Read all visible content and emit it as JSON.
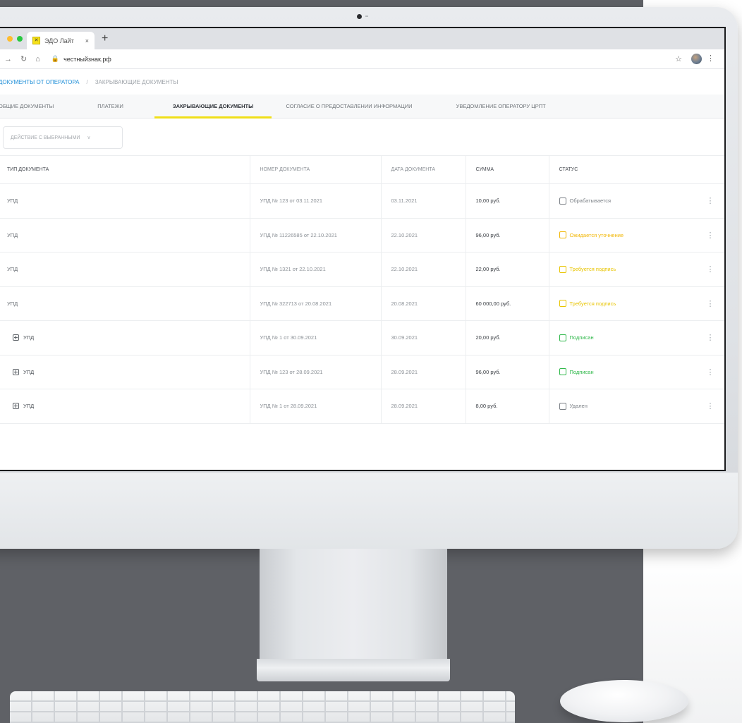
{
  "browser": {
    "tab_title": "ЭДО Лайт",
    "tab_close": "×",
    "new_tab": "+",
    "url": "честныйзнак.рф"
  },
  "breadcrumb": {
    "root": "ДОКУМЕНТЫ ОТ ОПЕРАТОРА",
    "separator": "/",
    "current": "ЗАКРЫВАЮЩИЕ ДОКУМЕНТЫ"
  },
  "tabs": [
    {
      "label": "ОБЩИЕ ДОКУМЕНТЫ",
      "active": false
    },
    {
      "label": "ПЛАТЕЖИ",
      "active": false
    },
    {
      "label": "ЗАКРЫВАЮЩИЕ ДОКУМЕНТЫ",
      "active": true
    },
    {
      "label": "СОГЛАСИЕ О ПРЕДОСТАВЛЕНИИ ИНФОРМАЦИИ",
      "active": false
    },
    {
      "label": "УВЕДОМЛЕНИЕ ОПЕРАТОРУ ЦРПТ",
      "active": false
    }
  ],
  "actions": {
    "label": "ДЕЙСТВИЕ С ВЫБРАННЫМИ",
    "chevron": "∨"
  },
  "table": {
    "headers": {
      "type": "ТИП ДОКУМЕНТА",
      "number": "НОМЕР ДОКУМЕНТА",
      "date": "ДАТА ДОКУМЕНТА",
      "sum": "СУММА",
      "status": "СТАТУС"
    },
    "rows": [
      {
        "type": "УПД",
        "number": "УПД № 123 от 03.11.2021",
        "date": "03.11.2021",
        "sum": "10,00 руб.",
        "status": "Обрабатывается",
        "status_color": "#7b8086",
        "expandable": false
      },
      {
        "type": "УПД",
        "number": "УПД № 11226585 от 22.10.2021",
        "date": "22.10.2021",
        "sum": "96,00 руб.",
        "status": "Ожидается уточнение",
        "status_color": "#f2b705",
        "expandable": false
      },
      {
        "type": "УПД",
        "number": "УПД № 1321 от 22.10.2021",
        "date": "22.10.2021",
        "sum": "22,00 руб.",
        "status": "Требуется подпись",
        "status_color": "#e8c400",
        "expandable": false
      },
      {
        "type": "УПД",
        "number": "УПД № 322713 от 20.08.2021",
        "date": "20.08.2021",
        "sum": "60 000,00 руб.",
        "status": "Требуется подпись",
        "status_color": "#e8c400",
        "expandable": false
      },
      {
        "type": "УПД",
        "number": "УПД № 1 от 30.09.2021",
        "date": "30.09.2021",
        "sum": "20,00 руб.",
        "status": "Подписан",
        "status_color": "#2fb84a",
        "expandable": true
      },
      {
        "type": "УПД",
        "number": "УПД № 123 от 28.09.2021",
        "date": "28.09.2021",
        "sum": "96,00 руб.",
        "status": "Подписан",
        "status_color": "#2fb84a",
        "expandable": true
      },
      {
        "type": "УПД",
        "number": "УПД № 1 от 28.09.2021",
        "date": "28.09.2021",
        "sum": "8,00 руб.",
        "status": "Удален",
        "status_color": "#7b8086",
        "expandable": true
      }
    ],
    "row_menu": "⋮"
  },
  "icons": {
    "tab_favicon": "edo-logo-icon",
    "back": "arrow-left-icon",
    "forward": "arrow-right-icon",
    "reload": "reload-icon",
    "home": "home-icon",
    "lock": "lock-icon",
    "bookmark": "star-icon",
    "profile": "avatar",
    "more": "more-vertical-icon"
  },
  "colors": {
    "accent_link": "#1f8fd8",
    "tab_underline": "#f0df1a"
  }
}
